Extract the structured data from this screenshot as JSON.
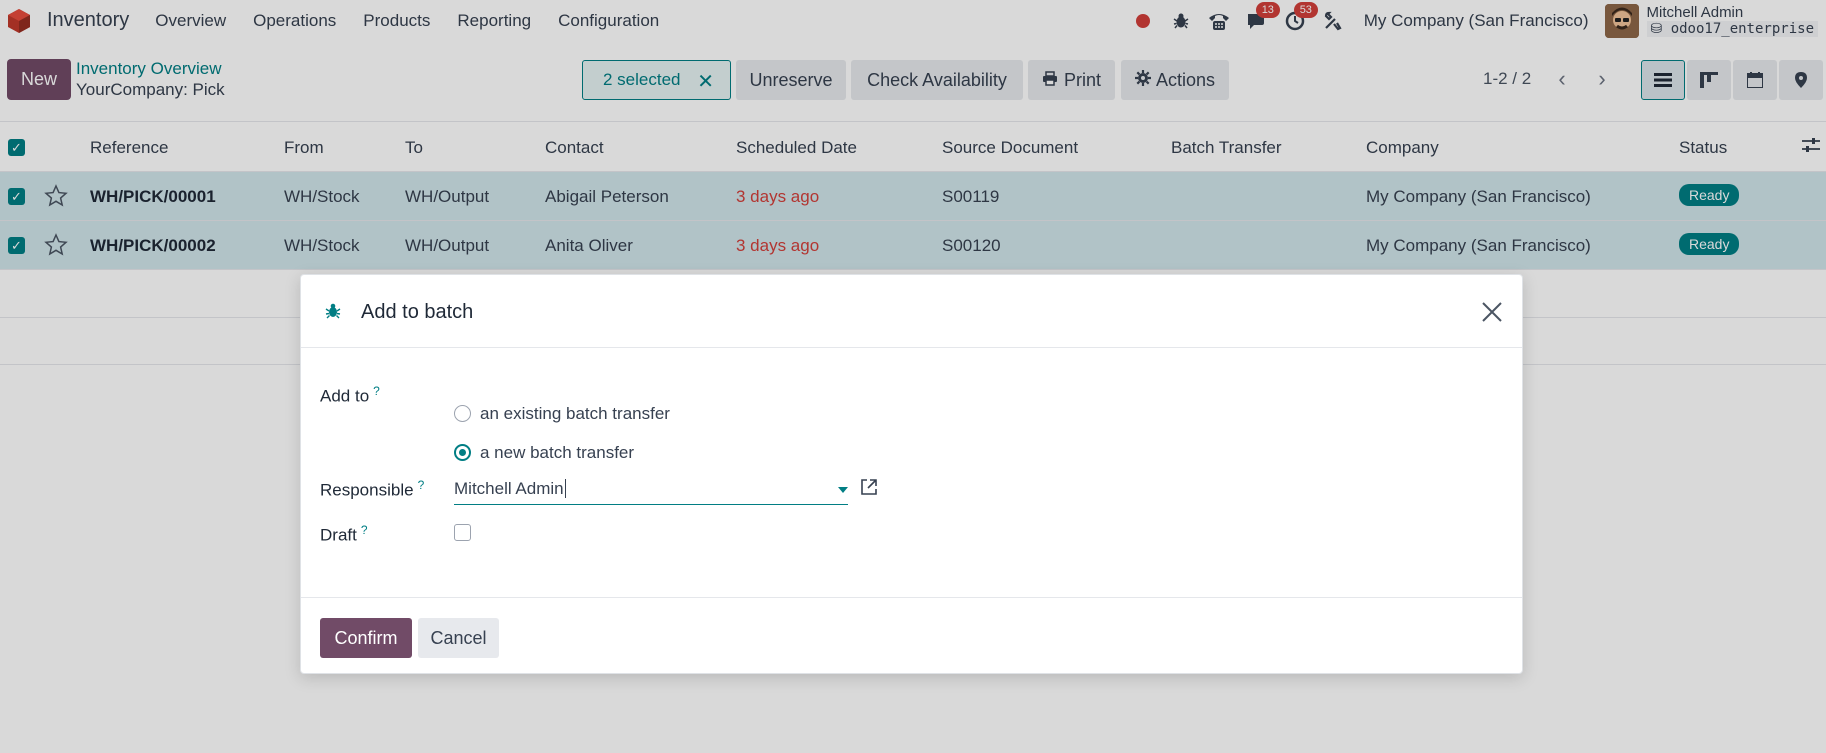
{
  "navbar": {
    "app_name": "Inventory",
    "menu": [
      "Overview",
      "Operations",
      "Products",
      "Reporting",
      "Configuration"
    ],
    "badges": {
      "messages": "13",
      "activities": "53"
    },
    "company": "My Company (San Francisco)",
    "user_name": "Mitchell Admin",
    "db_name": "odoo17_enterprise",
    "icons": [
      "record-icon",
      "bug-icon",
      "phone-icon",
      "chat-icon",
      "clock-icon",
      "tools-icon"
    ]
  },
  "control_panel": {
    "new_label": "New",
    "breadcrumb_parent": "Inventory Overview",
    "breadcrumb_current": "YourCompany: Pick",
    "selected_label": "2 selected",
    "unreserve_label": "Unreserve",
    "check_availability_label": "Check Availability",
    "print_label": "Print",
    "actions_label": "Actions",
    "pager": "1-2 / 2"
  },
  "list": {
    "columns": [
      "Reference",
      "From",
      "To",
      "Contact",
      "Scheduled Date",
      "Source Document",
      "Batch Transfer",
      "Company",
      "Status"
    ],
    "rows": [
      {
        "reference": "WH/PICK/00001",
        "from": "WH/Stock",
        "to": "WH/Output",
        "contact": "Abigail Peterson",
        "scheduled": "3 days ago",
        "source": "S00119",
        "batch": "",
        "company": "My Company (San Francisco)",
        "status": "Ready"
      },
      {
        "reference": "WH/PICK/00002",
        "from": "WH/Stock",
        "to": "WH/Output",
        "contact": "Anita Oliver",
        "scheduled": "3 days ago",
        "source": "S00120",
        "batch": "",
        "company": "My Company (San Francisco)",
        "status": "Ready"
      }
    ]
  },
  "dialog": {
    "title": "Add to batch",
    "add_to_label": "Add to",
    "help_mark": "?",
    "option_existing": "an existing batch transfer",
    "option_new": "a new batch transfer",
    "selected_option": "a new batch transfer",
    "responsible_label": "Responsible",
    "responsible_value": "Mitchell Admin",
    "draft_label": "Draft",
    "draft_checked": false,
    "confirm_label": "Confirm",
    "cancel_label": "Cancel"
  },
  "colors": {
    "primary": "#714b67",
    "accent": "#017e84",
    "danger": "#d23f3a",
    "selected_row": "#d1e5ea"
  }
}
